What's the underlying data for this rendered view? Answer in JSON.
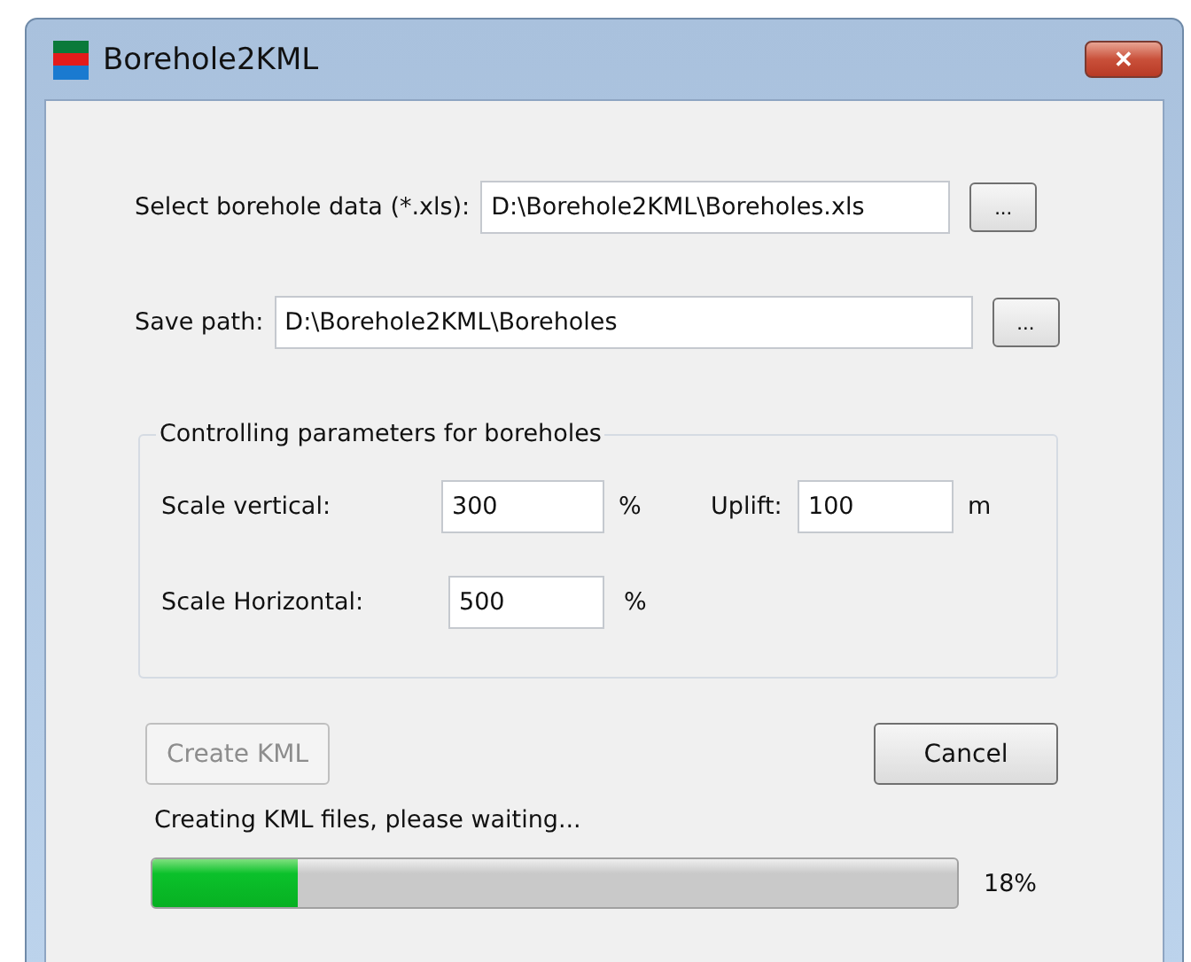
{
  "window": {
    "title": "Borehole2KML",
    "close_label": "✕"
  },
  "input_row": {
    "label": "Select borehole data (*.xls):",
    "value": "D:\\Borehole2KML\\Boreholes.xls",
    "browse": "..."
  },
  "save_row": {
    "label": "Save path:",
    "value": "D:\\Borehole2KML\\Boreholes",
    "browse": "..."
  },
  "group": {
    "title": "Controlling parameters for boreholes",
    "params": [
      {
        "label": "Scale vertical:",
        "value": "300",
        "unit": "%"
      },
      {
        "label": "Uplift:",
        "value": "100",
        "unit": "m"
      },
      {
        "label": "Scale Horizontal:",
        "value": "500",
        "unit": "%"
      }
    ]
  },
  "buttons": [
    {
      "label": "Create KML",
      "disabled": true
    },
    {
      "label": "Cancel",
      "disabled": false
    }
  ],
  "status": "Creating KML files, please waiting...",
  "progress": {
    "level": 0.18,
    "reading": "18%"
  }
}
